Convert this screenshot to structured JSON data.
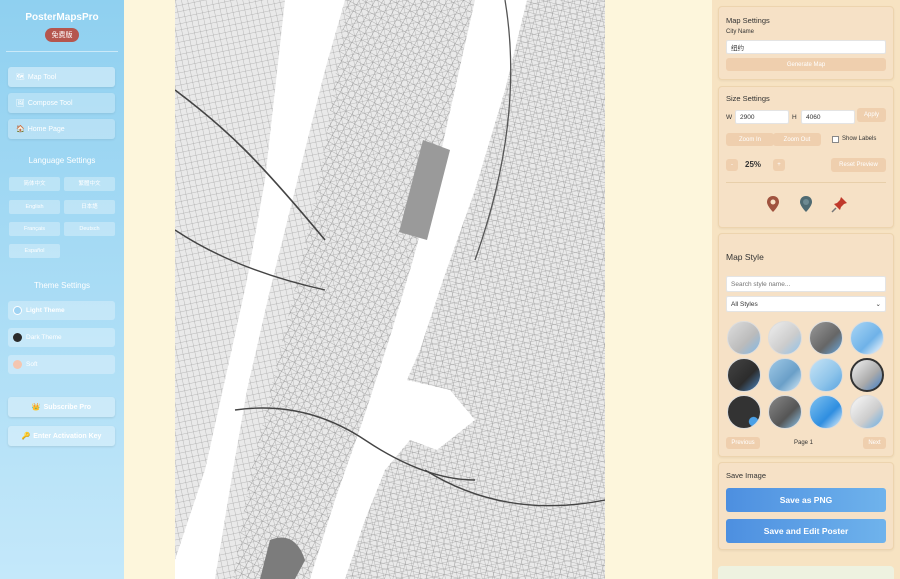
{
  "sidebar": {
    "brand": "PosterMapsPro",
    "badge": "免费版",
    "nav": [
      {
        "icon": "map-icon",
        "label": "Map Tool",
        "glyph": "🗺"
      },
      {
        "icon": "compose-icon",
        "label": "Compose Tool",
        "glyph": "🖼"
      },
      {
        "icon": "home-icon",
        "label": "Home Page",
        "glyph": "🏠"
      }
    ],
    "language_title": "Language Settings",
    "languages": [
      "简体中文",
      "繁體中文",
      "English",
      "日本語",
      "Français",
      "Deutsch",
      "Español"
    ],
    "theme_title": "Theme Settings",
    "themes": [
      {
        "label": "Light Theme",
        "color": "#9fd3f3"
      },
      {
        "label": "Dark Theme",
        "color": "#2c2c2c"
      },
      {
        "label": "Soft",
        "color": "#f4c6b0"
      }
    ],
    "subscribe": "Subscribe Pro",
    "activation": "Enter Activation Key"
  },
  "map_settings": {
    "title": "Map Settings",
    "city_label": "City Name",
    "city_value": "纽约",
    "generate": "Generate Map"
  },
  "size_settings": {
    "title": "Size Settings",
    "w_label": "W",
    "w_value": "2900",
    "h_label": "H",
    "h_value": "4060",
    "apply": "Apply",
    "zoom_in": "Zoom In",
    "zoom_out": "Zoom Out",
    "show_labels": "Show Labels",
    "minus": "-",
    "plus": "+",
    "zoom_level": "25%",
    "reset": "Reset Preview"
  },
  "map_style": {
    "title": "Map Style",
    "search_placeholder": "Search style name...",
    "filter": "All Styles",
    "previous": "Previous",
    "page": "Page 1",
    "next": "Next"
  },
  "save": {
    "title": "Save Image",
    "png": "Save as PNG",
    "edit": "Save and Edit Poster"
  },
  "colors": {
    "accent_blue": "#4d8fe0",
    "sidebar": "#a9dcf5",
    "panel": "#f6e1c6",
    "badge": "#b5564e"
  }
}
